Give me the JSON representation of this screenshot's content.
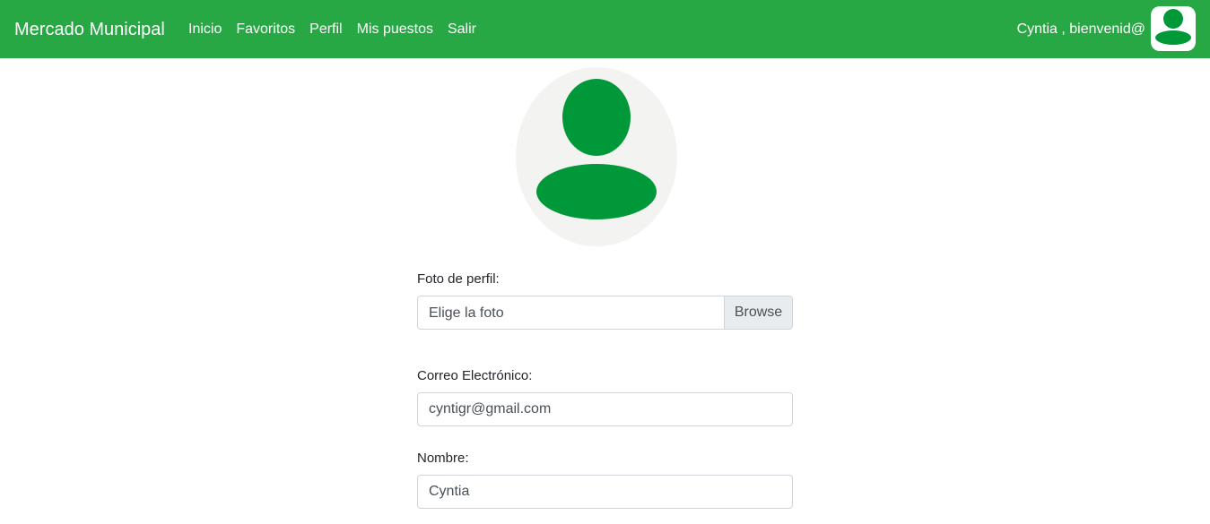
{
  "navbar": {
    "brand": "Mercado Municipal",
    "links": [
      "Inicio",
      "Favoritos",
      "Perfil",
      "Mis puestos",
      "Salir"
    ],
    "welcome": "Cyntia , bienvenid@",
    "avatar_icon": "user-icon"
  },
  "profile": {
    "avatar_icon": "user-icon",
    "photo_label": "Foto de perfil:",
    "photo_placeholder": "Elige la foto",
    "browse_label": "Browse",
    "email_label": "Correo Electrónico:",
    "email_value": "cyntigr@gmail.com",
    "name_label": "Nombre:",
    "name_value": "Cyntia"
  },
  "colors": {
    "navbar": "#28a745",
    "avatar_figure": "#019839",
    "avatar_background": "#f3f3f1"
  }
}
